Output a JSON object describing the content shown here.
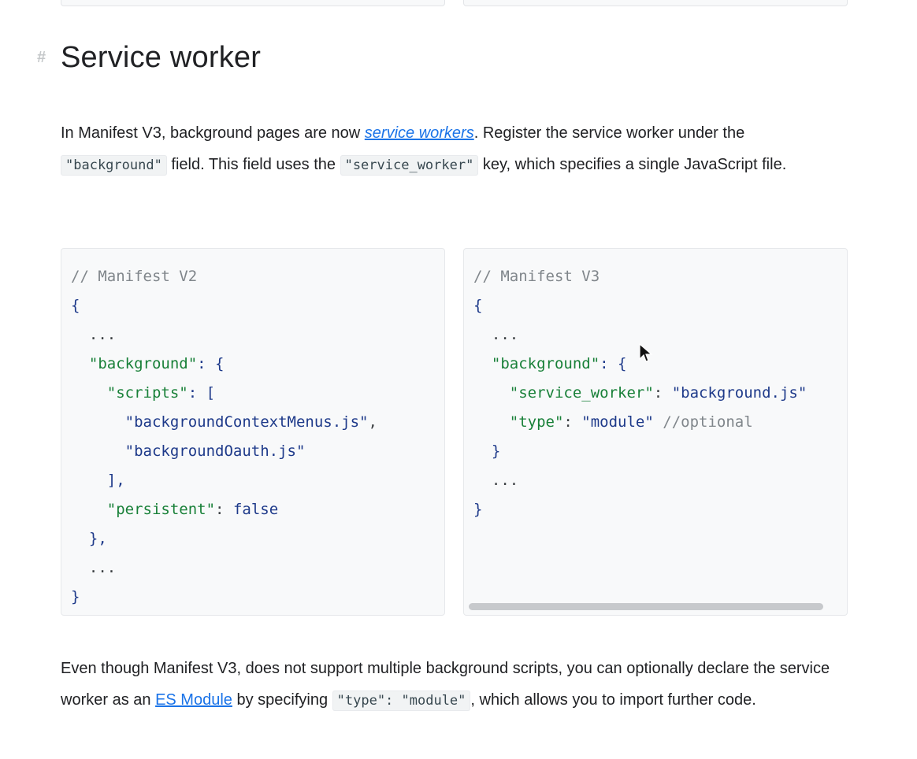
{
  "heading": {
    "hash": "#",
    "title": "Service worker"
  },
  "para1": {
    "t1": "In Manifest V3, background pages are now ",
    "link": "service workers",
    "t2": ". Register the service worker under the ",
    "code1": "\"background\"",
    "t3": " field. This field uses the ",
    "code2": "\"service_worker\"",
    "t4": " key, which specifies a single JavaScript file."
  },
  "code_v2": {
    "comment": "// Manifest V2",
    "open_brace": "{",
    "ellipsis1": "  ...",
    "bg_key": "\"background\"",
    "bg_rest": ": {",
    "scripts_key": "\"scripts\"",
    "scripts_rest": ": [",
    "file1": "\"backgroundContextMenus.js\"",
    "file1_comma": ",",
    "file2": "\"backgroundOauth.js\"",
    "close_bracket": "    ],",
    "persistent_key": "\"persistent\"",
    "persistent_colon": ": ",
    "persistent_val": "false",
    "close_obj": "  },",
    "ellipsis2": "  ...",
    "close_brace": "}"
  },
  "code_v3": {
    "comment": "// Manifest V3",
    "open_brace": "{",
    "ellipsis1": "  ...",
    "bg_key": "\"background\"",
    "bg_rest": ": {",
    "sw_key": "\"service_worker\"",
    "sw_colon": ": ",
    "sw_val": "\"background.js\"",
    "type_key": "\"type\"",
    "type_colon": ": ",
    "type_val": "\"module\"",
    "type_comment": " //optional",
    "close_obj": "  }",
    "ellipsis2": "  ...",
    "close_brace": "}"
  },
  "para2": {
    "t1": "Even though Manifest V3, does not support multiple background scripts, you can optionally declare the service worker as an ",
    "link": "ES Module",
    "t2": " by specifying ",
    "code": "\"type\": \"module\"",
    "t3": ", which allows you to import further code."
  }
}
